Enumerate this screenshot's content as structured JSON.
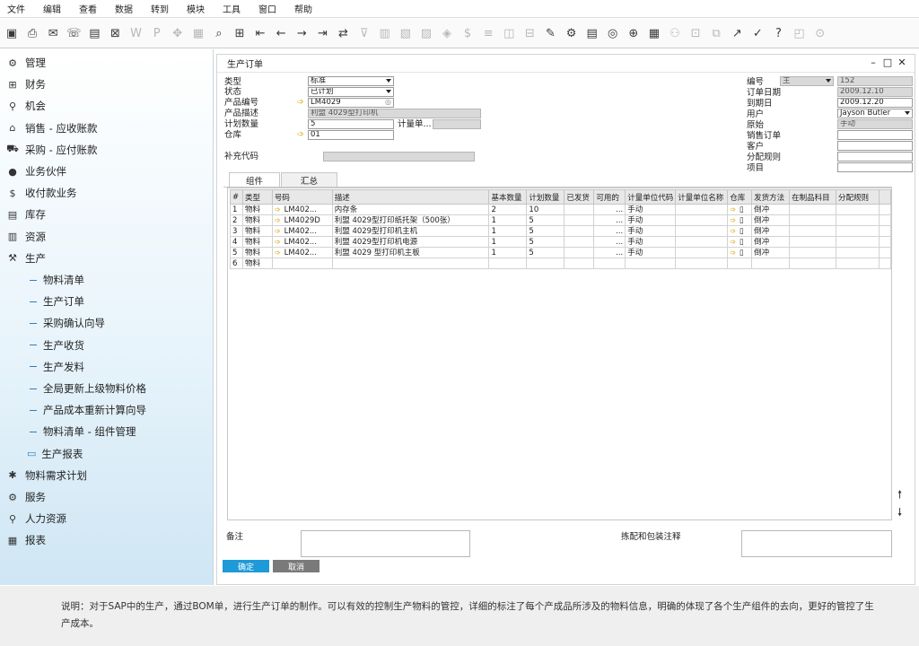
{
  "menu": [
    "文件",
    "编辑",
    "查看",
    "数据",
    "转到",
    "模块",
    "工具",
    "窗口",
    "帮助"
  ],
  "toolbar_icons": [
    {
      "name": "print-preview-icon",
      "glyph": "▣",
      "dim": false
    },
    {
      "name": "print-icon",
      "glyph": "⎙",
      "dim": false
    },
    {
      "name": "email-icon",
      "glyph": "✉",
      "dim": false
    },
    {
      "name": "sms-icon",
      "glyph": "☏",
      "dim": false
    },
    {
      "name": "fax-icon",
      "glyph": "▤",
      "dim": false
    },
    {
      "name": "excel-icon",
      "glyph": "⊠",
      "dim": false
    },
    {
      "name": "word-icon",
      "glyph": "W",
      "dim": true
    },
    {
      "name": "pdf-icon",
      "glyph": "P",
      "dim": true
    },
    {
      "name": "move-icon",
      "glyph": "✥",
      "dim": true
    },
    {
      "name": "layout-icon",
      "glyph": "▦",
      "dim": true
    },
    {
      "name": "find-icon",
      "glyph": "⌕",
      "dim": false
    },
    {
      "name": "add-icon",
      "glyph": "⊞",
      "dim": false
    },
    {
      "name": "first-record-icon",
      "glyph": "⇤",
      "dim": false
    },
    {
      "name": "previous-record-icon",
      "glyph": "←",
      "dim": false
    },
    {
      "name": "next-record-icon",
      "glyph": "→",
      "dim": false
    },
    {
      "name": "last-record-icon",
      "glyph": "⇥",
      "dim": false
    },
    {
      "name": "refresh-icon",
      "glyph": "⇄",
      "dim": false
    },
    {
      "name": "filter-icon",
      "glyph": "⊽",
      "dim": true
    },
    {
      "name": "sort-icon",
      "glyph": "▥",
      "dim": true
    },
    {
      "name": "base-document-icon",
      "glyph": "▧",
      "dim": true
    },
    {
      "name": "target-document-icon",
      "glyph": "▨",
      "dim": true
    },
    {
      "name": "relation-map-icon",
      "glyph": "◈",
      "dim": true
    },
    {
      "name": "payment-icon",
      "glyph": "$",
      "dim": true
    },
    {
      "name": "journal-icon",
      "glyph": "≡",
      "dim": true
    },
    {
      "name": "column-settings-icon",
      "glyph": "◫",
      "dim": true
    },
    {
      "name": "form-settings-icon",
      "glyph": "⊟",
      "dim": true
    },
    {
      "name": "edit-icon",
      "glyph": "✎",
      "dim": false
    },
    {
      "name": "settings-icon",
      "glyph": "⚙",
      "dim": false
    },
    {
      "name": "report-icon",
      "glyph": "▤",
      "dim": false
    },
    {
      "name": "query-icon",
      "glyph": "◎",
      "dim": false
    },
    {
      "name": "alert-icon",
      "glyph": "⊕",
      "dim": false
    },
    {
      "name": "calendar-icon",
      "glyph": "▦",
      "dim": false
    },
    {
      "name": "user-icon",
      "glyph": "⚇",
      "dim": true
    },
    {
      "name": "message-icon",
      "glyph": "⊡",
      "dim": true
    },
    {
      "name": "link-icon",
      "glyph": "⧉",
      "dim": true
    },
    {
      "name": "chart-icon",
      "glyph": "↗",
      "dim": false
    },
    {
      "name": "approve-icon",
      "glyph": "✓",
      "dim": false
    },
    {
      "name": "help-icon",
      "glyph": "?",
      "dim": false
    },
    {
      "name": "web-icon",
      "glyph": "◰",
      "dim": true
    },
    {
      "name": "exit-icon",
      "glyph": "⊙",
      "dim": true
    }
  ],
  "sidebar": {
    "modules": [
      {
        "label": "管理",
        "icon": "admin-icon",
        "glyph": "⚙"
      },
      {
        "label": "财务",
        "icon": "finance-icon",
        "glyph": "⊞"
      },
      {
        "label": "机会",
        "icon": "opportunity-icon",
        "glyph": "⚲"
      },
      {
        "label": "销售 - 应收账款",
        "icon": "sales-icon",
        "glyph": "⌂"
      },
      {
        "label": "采购 - 应付账款",
        "icon": "purchasing-icon",
        "glyph": "⛟"
      },
      {
        "label": "业务伙伴",
        "icon": "business-partner-icon",
        "glyph": "●"
      },
      {
        "label": "收付款业务",
        "icon": "banking-icon",
        "glyph": "$"
      },
      {
        "label": "库存",
        "icon": "inventory-icon",
        "glyph": "▤"
      },
      {
        "label": "资源",
        "icon": "resources-icon",
        "glyph": "▥"
      },
      {
        "label": "生产",
        "icon": "production-icon",
        "glyph": "⚒"
      }
    ],
    "production_sub": [
      {
        "label": "物料清单"
      },
      {
        "label": "生产订单"
      },
      {
        "label": "采购确认向导"
      },
      {
        "label": "生产收货"
      },
      {
        "label": "生产发料"
      },
      {
        "label": "全局更新上级物料价格"
      },
      {
        "label": "产品成本重新计算向导"
      },
      {
        "label": "物料清单 - 组件管理"
      }
    ],
    "production_folder": "生产报表",
    "modules_after": [
      {
        "label": "物料需求计划",
        "icon": "mrp-icon",
        "glyph": "✱"
      },
      {
        "label": "服务",
        "icon": "service-icon",
        "glyph": "⚙"
      },
      {
        "label": "人力资源",
        "icon": "hr-icon",
        "glyph": "⚲"
      },
      {
        "label": "报表",
        "icon": "reports-icon",
        "glyph": "▦"
      }
    ]
  },
  "doc": {
    "title": "生产订单",
    "left_labels": [
      "类型",
      "状态",
      "产品编号",
      "产品描述",
      "计划数量",
      "仓库"
    ],
    "type_value": "标准",
    "status_value": "已计划",
    "product_no": "LM4029",
    "product_desc": "利盟 4029型打印机",
    "planned_qty": "5",
    "uom_label": "计量单...",
    "warehouse": "01",
    "extra_code_label": "补充代码",
    "right_labels": [
      "编号",
      "订单日期",
      "到期日",
      "用户",
      "原始",
      "销售订单",
      "客户",
      "分配规则",
      "项目"
    ],
    "series": "主",
    "doc_no": "152",
    "order_date": "2009.12.10",
    "due_date": "2009.12.20",
    "user": "Jayson Butler",
    "origin": "手动"
  },
  "tabs": [
    "组件",
    "汇总"
  ],
  "grid": {
    "columns": [
      "#",
      "类型",
      "号码",
      "描述",
      "基本数量",
      "计划数量",
      "已发货",
      "可用的",
      "计量单位代码",
      "计量单位名称",
      "仓库",
      "发货方法",
      "在制品科目",
      "分配规则"
    ],
    "rows": [
      {
        "n": "1",
        "type": "物料",
        "code": "LM402...",
        "desc": "内存条",
        "base": "2",
        "plan": "10",
        "avail": "...",
        "uom": "手动",
        "method": "倒冲",
        "wh": "▯"
      },
      {
        "n": "2",
        "type": "物料",
        "code": "LM4029D",
        "desc": "利盟 4029型打印纸托架（500张）",
        "base": "1",
        "plan": "5",
        "avail": "...",
        "uom": "手动",
        "method": "倒冲",
        "wh": "▯"
      },
      {
        "n": "3",
        "type": "物料",
        "code": "LM402...",
        "desc": "利盟 4029型打印机主机",
        "base": "1",
        "plan": "5",
        "avail": "...",
        "uom": "手动",
        "method": "倒冲",
        "wh": "▯"
      },
      {
        "n": "4",
        "type": "物料",
        "code": "LM402...",
        "desc": "利盟 4029型打印机电源",
        "base": "1",
        "plan": "5",
        "avail": "...",
        "uom": "手动",
        "method": "倒冲",
        "wh": "▯"
      },
      {
        "n": "5",
        "type": "物料",
        "code": "LM402...",
        "desc": "利盟 4029 型打印机主板",
        "base": "1",
        "plan": "5",
        "avail": "...",
        "uom": "手动",
        "method": "倒冲",
        "wh": "▯"
      },
      {
        "n": "6",
        "type": "物料",
        "code": "",
        "desc": "",
        "base": "",
        "plan": "",
        "avail": "",
        "uom": "",
        "method": "",
        "wh": ""
      }
    ]
  },
  "bottom": {
    "remarks_label": "备注",
    "pick_label": "拣配和包装注释",
    "ok_label": "确定",
    "cancel_label": "取消"
  },
  "caption": "说明：对于SAP中的生产，通过BOM单，进行生产订单的制作。可以有效的控制生产物料的管控，详细的标注了每个产成品所涉及的物料信息，明确的体现了各个生产组件的去向，更好的管控了生产成本。",
  "colors": {
    "accent": "#1f9ad8",
    "arrow": "#e0a000"
  }
}
